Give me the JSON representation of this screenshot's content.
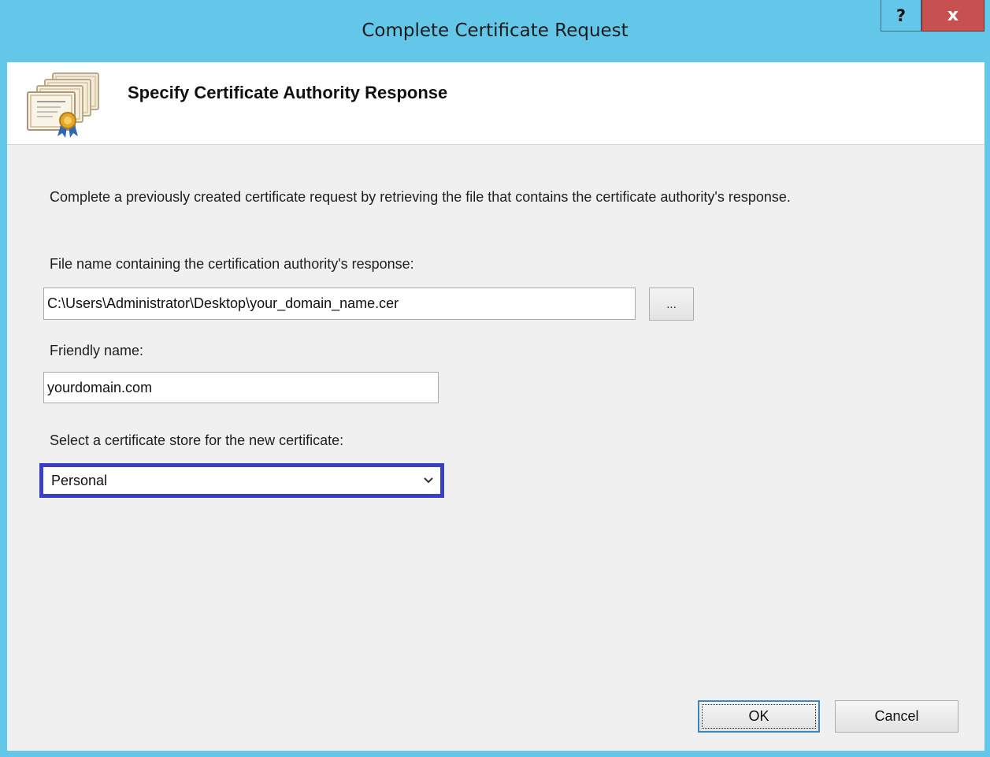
{
  "window": {
    "title": "Complete Certificate Request",
    "help_label": "?",
    "close_label": "x"
  },
  "header": {
    "title": "Specify Certificate Authority Response",
    "icon": "certificate-icon"
  },
  "form": {
    "description": "Complete a previously created certificate request by retrieving the file that contains the certificate authority's response.",
    "file_label": "File name containing the certification authority's response:",
    "file_value": "C:\\Users\\Administrator\\Desktop\\your_domain_name.cer",
    "browse_label": "...",
    "friendly_label": "Friendly name:",
    "friendly_value": "yourdomain.com",
    "store_label": "Select a certificate store for the new certificate:",
    "store_selected": "Personal"
  },
  "buttons": {
    "ok": "OK",
    "cancel": "Cancel"
  },
  "colors": {
    "titlebar": "#63c7ea",
    "close": "#c75050",
    "focus_border": "#3b3fc4"
  }
}
